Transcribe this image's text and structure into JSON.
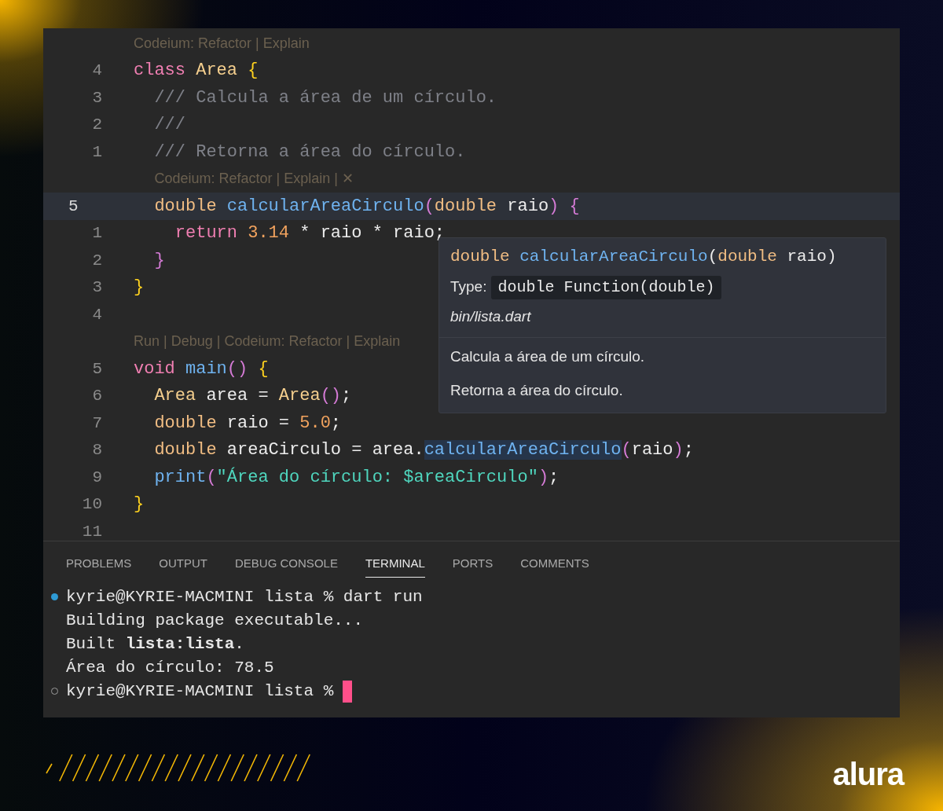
{
  "editor": {
    "lines": [
      {
        "kind": "codelens",
        "text": "Codeium: Refactor | Explain"
      },
      {
        "kind": "code",
        "number": "4",
        "current": false,
        "tokens": [
          {
            "kind": "keyword",
            "text": "class "
          },
          {
            "kind": "type",
            "text": "Area "
          },
          {
            "kind": "brace",
            "text": "{"
          }
        ]
      },
      {
        "kind": "code",
        "number": "3",
        "current": false,
        "tokens": [
          {
            "kind": "comment",
            "text": "  /// Calcula a área de um círculo."
          }
        ]
      },
      {
        "kind": "code",
        "number": "2",
        "current": false,
        "tokens": [
          {
            "kind": "comment",
            "text": "  ///"
          }
        ]
      },
      {
        "kind": "code",
        "number": "1",
        "current": false,
        "tokens": [
          {
            "kind": "comment",
            "text": "  /// Retorna a área do círculo."
          }
        ]
      },
      {
        "kind": "codelens",
        "text": "  Codeium: Refactor | Explain | ✕"
      },
      {
        "kind": "code",
        "number": "5",
        "current": true,
        "tokens": [
          {
            "kind": "type2",
            "text": "  double "
          },
          {
            "kind": "function",
            "text": "calcularAreaCirculo"
          },
          {
            "kind": "paren",
            "text": "("
          },
          {
            "kind": "type2",
            "text": "double "
          },
          {
            "kind": "plain",
            "text": "raio"
          },
          {
            "kind": "paren",
            "text": ") {"
          }
        ]
      },
      {
        "kind": "code",
        "number": "1",
        "current": false,
        "tokens": [
          {
            "kind": "keyword",
            "text": "    return "
          },
          {
            "kind": "number",
            "text": "3.14 "
          },
          {
            "kind": "plain",
            "text": "* raio * raio;"
          }
        ]
      },
      {
        "kind": "code",
        "number": "2",
        "current": false,
        "tokens": [
          {
            "kind": "paren",
            "text": "  }"
          }
        ]
      },
      {
        "kind": "code",
        "number": "3",
        "current": false,
        "tokens": [
          {
            "kind": "brace",
            "text": "}"
          }
        ]
      },
      {
        "kind": "code",
        "number": "4",
        "current": false
      },
      {
        "kind": "codelens",
        "text": "Run | Debug | Codeium: Refactor | Explain"
      },
      {
        "kind": "code",
        "number": "5",
        "current": false,
        "tokens": [
          {
            "kind": "keyword",
            "text": "void "
          },
          {
            "kind": "function",
            "text": "main"
          },
          {
            "kind": "paren",
            "text": "() "
          },
          {
            "kind": "brace",
            "text": "{"
          }
        ]
      },
      {
        "kind": "code",
        "number": "6",
        "current": false,
        "tokens": [
          {
            "kind": "type",
            "text": "  Area "
          },
          {
            "kind": "plain",
            "text": "area = "
          },
          {
            "kind": "type",
            "text": "Area"
          },
          {
            "kind": "paren",
            "text": "()"
          },
          {
            "kind": "plain",
            "text": ";"
          }
        ]
      },
      {
        "kind": "code",
        "number": "7",
        "current": false,
        "tokens": [
          {
            "kind": "type2",
            "text": "  double "
          },
          {
            "kind": "plain",
            "text": "raio = "
          },
          {
            "kind": "number",
            "text": "5.0"
          },
          {
            "kind": "plain",
            "text": ";"
          }
        ]
      },
      {
        "kind": "code",
        "number": "8",
        "current": false,
        "tokens": [
          {
            "kind": "type2",
            "text": "  double "
          },
          {
            "kind": "plain",
            "text": "areaCirculo = area."
          },
          {
            "kind": "ref",
            "text": "calcularAreaCirculo"
          },
          {
            "kind": "paren",
            "text": "("
          },
          {
            "kind": "plain",
            "text": "raio"
          },
          {
            "kind": "paren",
            "text": ")"
          },
          {
            "kind": "plain",
            "text": ";"
          }
        ]
      },
      {
        "kind": "code",
        "number": "9",
        "current": false,
        "tokens": [
          {
            "kind": "function",
            "text": "  print"
          },
          {
            "kind": "paren",
            "text": "("
          },
          {
            "kind": "string",
            "text": "\"Área do círculo: $areaCirculo\""
          },
          {
            "kind": "paren",
            "text": ")"
          },
          {
            "kind": "plain",
            "text": ";"
          }
        ]
      },
      {
        "kind": "code",
        "number": "10",
        "current": false,
        "tokens": [
          {
            "kind": "brace",
            "text": "}"
          }
        ]
      },
      {
        "kind": "code",
        "number": "11",
        "current": false
      }
    ],
    "hover": {
      "signature": [
        {
          "kind": "type2",
          "text": "double "
        },
        {
          "kind": "function",
          "text": "calcularAreaCirculo"
        },
        {
          "kind": "plain",
          "text": "("
        },
        {
          "kind": "type2",
          "text": "double "
        },
        {
          "kind": "plain",
          "text": "raio)"
        }
      ],
      "type_label": "Type:",
      "type_value": "double Function(double)",
      "file": "bin/lista.dart",
      "docs": [
        "Calcula a área de um círculo.",
        "Retorna a área do círculo."
      ]
    }
  },
  "panel": {
    "tabs": [
      {
        "label": "PROBLEMS",
        "selected": false
      },
      {
        "label": "OUTPUT",
        "selected": false
      },
      {
        "label": "DEBUG CONSOLE",
        "selected": false
      },
      {
        "label": "TERMINAL",
        "selected": true
      },
      {
        "label": "PORTS",
        "selected": false
      },
      {
        "label": "COMMENTS",
        "selected": false
      }
    ],
    "terminal": [
      {
        "kind": "prompt-done",
        "text": "kyrie@KYRIE-MACMINI lista % dart run"
      },
      {
        "kind": "output",
        "text": "Building package executable..."
      },
      {
        "kind": "output",
        "text": "Built **lista:lista**."
      },
      {
        "kind": "output",
        "text": "Área do círculo: 78.5"
      },
      {
        "kind": "prompt-open",
        "text": "kyrie@KYRIE-MACMINI lista %"
      }
    ]
  },
  "logo": "alura"
}
